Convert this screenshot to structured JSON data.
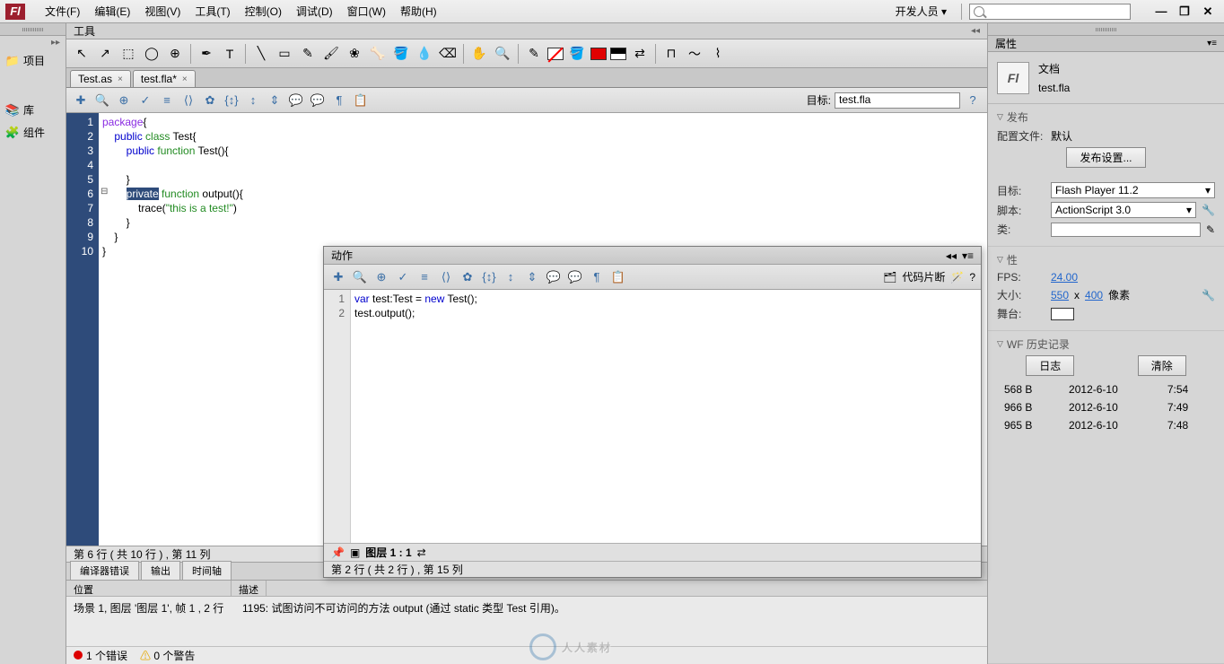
{
  "menubar": {
    "items": [
      "文件(F)",
      "编辑(E)",
      "视图(V)",
      "工具(T)",
      "控制(O)",
      "调试(D)",
      "窗口(W)",
      "帮助(H)"
    ],
    "developer": "开发人员  ▾"
  },
  "leftDock": {
    "items": [
      {
        "icon": "📁",
        "label": "项目"
      },
      {
        "icon": "📚",
        "label": "库"
      },
      {
        "icon": "🧩",
        "label": "组件"
      }
    ]
  },
  "toolPanel": {
    "title": "工具"
  },
  "tabs": [
    {
      "label": "Test.as",
      "close": "×"
    },
    {
      "label": "test.fla*",
      "close": "×"
    }
  ],
  "editorToolbar": {
    "targetLabel": "目标:",
    "targetValue": "test.fla"
  },
  "mainCode": {
    "lines": [
      "1",
      "2",
      "3",
      "4",
      "5",
      "6",
      "7",
      "8",
      "9",
      "10"
    ],
    "text": {
      "l1a": "package",
      "l1b": "{",
      "l2a": "    ",
      "l2b": "public",
      "l2c": " ",
      "l2d": "class",
      "l2e": " Test{",
      "l3a": "        ",
      "l3b": "public",
      "l3c": " ",
      "l3d": "function",
      "l3e": " Test(){",
      "l4": "",
      "l5": "        }",
      "l6a": "        ",
      "l6b": "private",
      "l6c": " ",
      "l6d": "function",
      "l6e": " output(){",
      "l7a": "            trace(",
      "l7b": "\"this is a test!\"",
      "l7c": ")",
      "l8": "        }",
      "l9": "    }",
      "l10": "}"
    },
    "status": "第 6 行 ( 共 10 行 ) , 第 11 列"
  },
  "bottomTabs": [
    "编译器错误",
    "输出",
    "时间轴"
  ],
  "errorPanel": {
    "col1": "位置",
    "col2": "描述",
    "row_loc": "场景 1, 图层 '图层 1', 帧 1 , 2 行",
    "row_desc": "1195: 试图访问不可访问的方法 output (通过 static 类型 Test 引用)。",
    "err_count": "1 个错误",
    "warn_count": "0 个警告"
  },
  "actionsPanel": {
    "title": "动作",
    "snippetLabel": "代码片断",
    "code": {
      "lines": [
        "1",
        "2"
      ],
      "l1a": "var",
      "l1b": " test:Test = ",
      "l1c": "new",
      "l1d": " Test();",
      "l2": "test.output();"
    },
    "layerLabel": "图层 1 : 1",
    "status": "第 2 行 ( 共 2 行 ) , 第 15 列"
  },
  "rightPanel": {
    "propsTitle": "属性",
    "docLabel": "文档",
    "docName": "test.fla",
    "publish": {
      "title": "发布",
      "profileLabel": "配置文件:",
      "profileValue": "默认",
      "settingsBtn": "发布设置...",
      "targetLabel": "目标:",
      "targetValue": "Flash Player 11.2",
      "scriptLabel": "脚本:",
      "scriptValue": "ActionScript 3.0",
      "classLabel": "类:"
    },
    "props": {
      "title": "性",
      "fpsLabel": "FPS:",
      "fpsValue": "24.00",
      "sizeLabel": "大小:",
      "w": "550",
      "x": "x",
      "h": "400",
      "unit": "像素",
      "stageLabel": "舞台:"
    },
    "history": {
      "title": "WF 历史记录",
      "logBtn": "日志",
      "clearBtn": "清除",
      "rows": [
        {
          "size": "568 B",
          "date": "2012-6-10",
          "time": "7:54"
        },
        {
          "size": "966 B",
          "date": "2012-6-10",
          "time": "7:49"
        },
        {
          "size": "965 B",
          "date": "2012-6-10",
          "time": "7:48"
        }
      ]
    }
  },
  "watermark": "人人素材"
}
